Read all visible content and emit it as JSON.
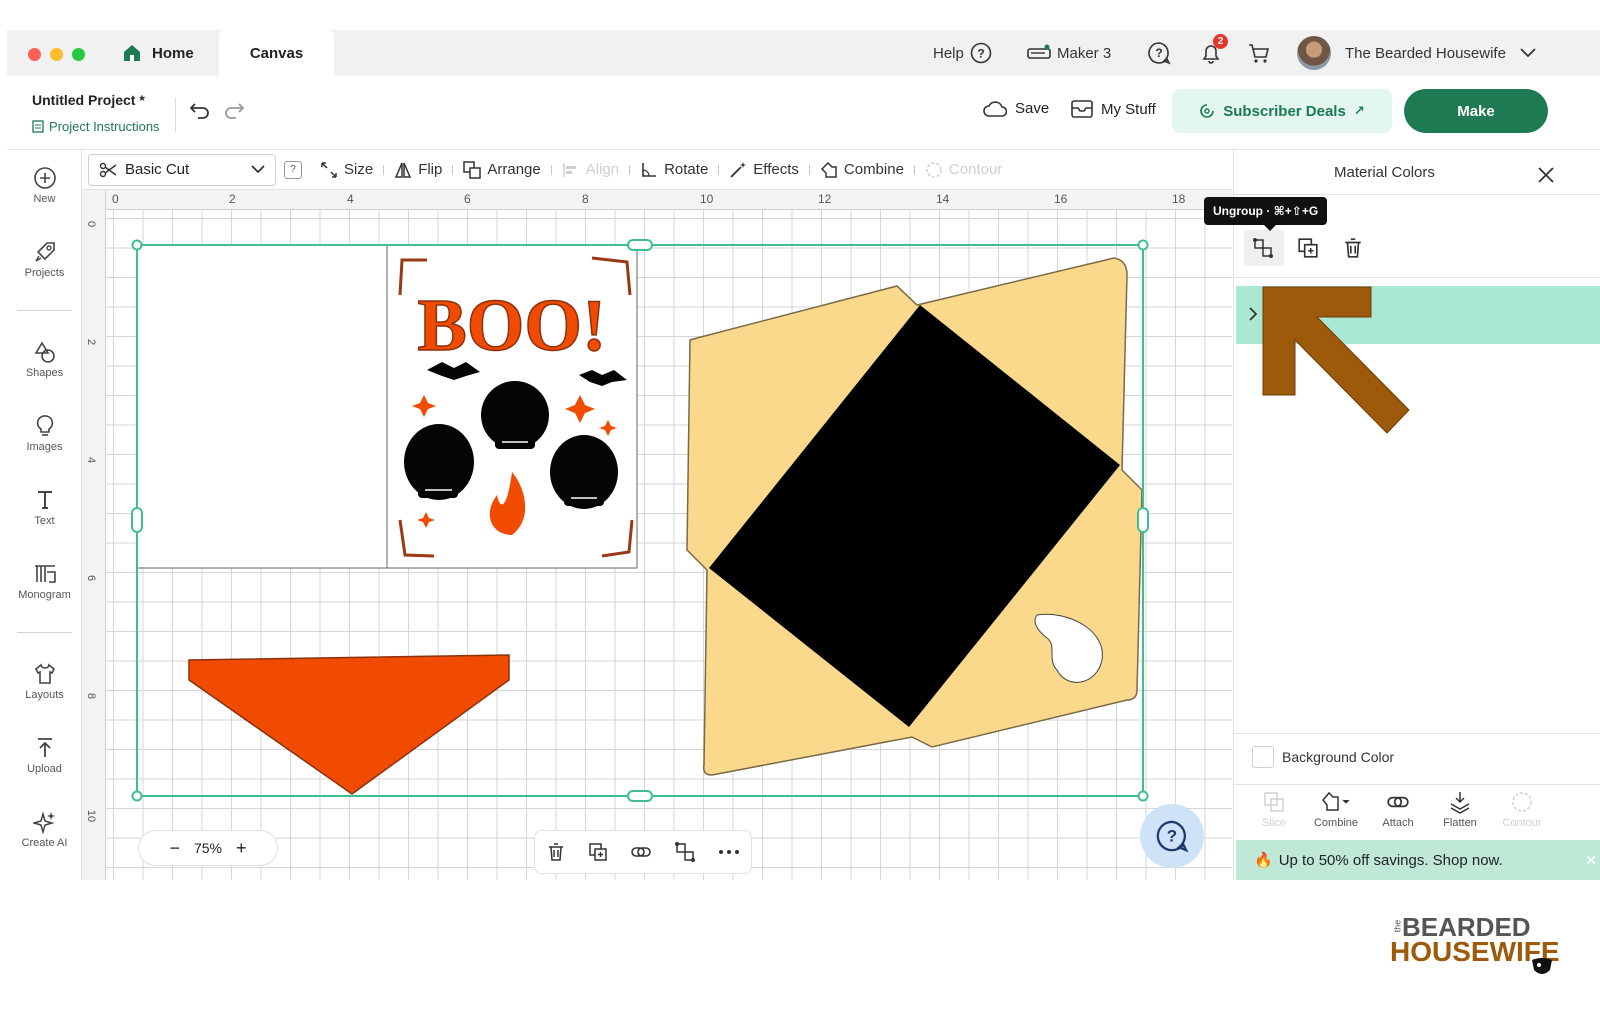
{
  "titlebar": {
    "tabs": [
      {
        "label": "Home"
      },
      {
        "label": "Canvas"
      }
    ],
    "help": "Help",
    "machine": "Maker 3",
    "notification_count": "2",
    "user_name": "The Bearded Housewife"
  },
  "header": {
    "project_title": "Untitled Project *",
    "project_instructions": "Project Instructions",
    "save": "Save",
    "my_stuff": "My Stuff",
    "subscriber_deals": "Subscriber Deals",
    "make": "Make"
  },
  "toolbar": {
    "operation": "Basic Cut",
    "help_badge": "?",
    "size": "Size",
    "flip": "Flip",
    "arrange": "Arrange",
    "align": "Align",
    "rotate": "Rotate",
    "effects": "Effects",
    "combine": "Combine",
    "contour": "Contour"
  },
  "sidebar": {
    "items": [
      {
        "label": "New"
      },
      {
        "label": "Projects"
      },
      {
        "label": "Shapes"
      },
      {
        "label": "Images"
      },
      {
        "label": "Text"
      },
      {
        "label": "Monogram"
      },
      {
        "label": "Layouts"
      },
      {
        "label": "Upload"
      },
      {
        "label": "Create AI"
      }
    ]
  },
  "canvas": {
    "ruler_top": [
      "0",
      "2",
      "4",
      "6",
      "8",
      "10",
      "12",
      "14",
      "16",
      "18"
    ],
    "ruler_left": [
      "0",
      "2",
      "4",
      "6",
      "8",
      "10"
    ],
    "card_text": "BOO!",
    "zoom": "75%",
    "zoom_minus": "−",
    "zoom_plus": "+"
  },
  "panel": {
    "header_title": "Material Colors",
    "tooltip": "Ungroup · ⌘+⇧+G",
    "background_color": "Background Color",
    "actions": [
      {
        "label": "Slice"
      },
      {
        "label": "Combine"
      },
      {
        "label": "Attach"
      },
      {
        "label": "Flatten"
      },
      {
        "label": "Contour"
      }
    ],
    "promo": "Up to 50% off savings. Shop now."
  },
  "watermark": {
    "line1": "BEARDED",
    "line2": "HOUSEWIFE",
    "small": "the"
  },
  "colors": {
    "accent_green": "#1e7a52",
    "selection": "#3fbf8f",
    "teal_row": "#abe8d3",
    "orange": "#f04b00",
    "envelope": "#fad98c",
    "arrow_brown": "#9c5a0a"
  }
}
